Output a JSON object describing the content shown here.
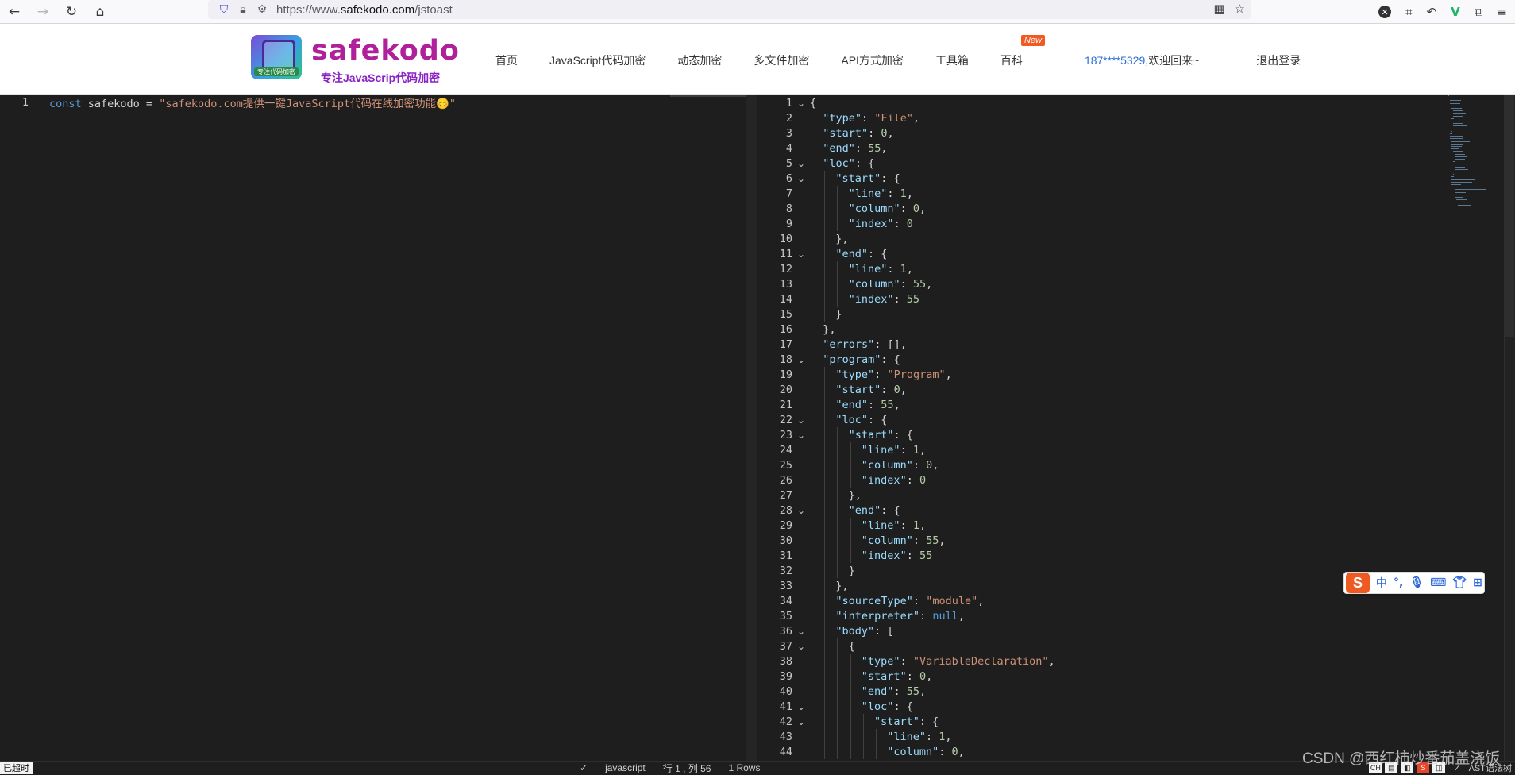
{
  "browser": {
    "url_prefix": "https://www.",
    "url_domain": "safekodo.com",
    "url_path": "/jstoast"
  },
  "site": {
    "logo_name": "safekodo",
    "logo_tagline": "专注JavaScrip代码加密",
    "logo_badge_text": "专注代码加密",
    "nav": [
      {
        "label": "首页"
      },
      {
        "label": "JavaScript代码加密"
      },
      {
        "label": "动态加密"
      },
      {
        "label": "多文件加密"
      },
      {
        "label": "API方式加密"
      },
      {
        "label": "工具箱"
      },
      {
        "label": "百科"
      }
    ],
    "new_badge": "New",
    "user_phone": "187****5329",
    "user_welcome": ",欢迎回来~",
    "logout": "退出登录"
  },
  "left_editor": {
    "line_number": "1",
    "keyword": "const",
    "ident": " safekodo = ",
    "string": "\"safekodo.com提供一键JavaScript代码在线加密功能😊\""
  },
  "right_editor": {
    "lines": [
      {
        "n": "1",
        "fold": true,
        "indent": 0,
        "parts": [
          [
            "p",
            "{"
          ]
        ]
      },
      {
        "n": "2",
        "fold": false,
        "indent": 1,
        "parts": [
          [
            "k",
            "\"type\""
          ],
          [
            "p",
            ": "
          ],
          [
            "s",
            "\"File\""
          ],
          [
            "p",
            ","
          ]
        ]
      },
      {
        "n": "3",
        "fold": false,
        "indent": 1,
        "parts": [
          [
            "k",
            "\"start\""
          ],
          [
            "p",
            ": "
          ],
          [
            "n",
            "0"
          ],
          [
            "p",
            ","
          ]
        ]
      },
      {
        "n": "4",
        "fold": false,
        "indent": 1,
        "parts": [
          [
            "k",
            "\"end\""
          ],
          [
            "p",
            ": "
          ],
          [
            "n",
            "55"
          ],
          [
            "p",
            ","
          ]
        ]
      },
      {
        "n": "5",
        "fold": true,
        "indent": 1,
        "parts": [
          [
            "k",
            "\"loc\""
          ],
          [
            "p",
            ": {"
          ]
        ]
      },
      {
        "n": "6",
        "fold": true,
        "indent": 2,
        "parts": [
          [
            "k",
            "\"start\""
          ],
          [
            "p",
            ": {"
          ]
        ]
      },
      {
        "n": "7",
        "fold": false,
        "indent": 3,
        "parts": [
          [
            "k",
            "\"line\""
          ],
          [
            "p",
            ": "
          ],
          [
            "n",
            "1"
          ],
          [
            "p",
            ","
          ]
        ]
      },
      {
        "n": "8",
        "fold": false,
        "indent": 3,
        "parts": [
          [
            "k",
            "\"column\""
          ],
          [
            "p",
            ": "
          ],
          [
            "n",
            "0"
          ],
          [
            "p",
            ","
          ]
        ]
      },
      {
        "n": "9",
        "fold": false,
        "indent": 3,
        "parts": [
          [
            "k",
            "\"index\""
          ],
          [
            "p",
            ": "
          ],
          [
            "n",
            "0"
          ]
        ]
      },
      {
        "n": "10",
        "fold": false,
        "indent": 2,
        "parts": [
          [
            "p",
            "},"
          ]
        ]
      },
      {
        "n": "11",
        "fold": true,
        "indent": 2,
        "parts": [
          [
            "k",
            "\"end\""
          ],
          [
            "p",
            ": {"
          ]
        ]
      },
      {
        "n": "12",
        "fold": false,
        "indent": 3,
        "parts": [
          [
            "k",
            "\"line\""
          ],
          [
            "p",
            ": "
          ],
          [
            "n",
            "1"
          ],
          [
            "p",
            ","
          ]
        ]
      },
      {
        "n": "13",
        "fold": false,
        "indent": 3,
        "parts": [
          [
            "k",
            "\"column\""
          ],
          [
            "p",
            ": "
          ],
          [
            "n",
            "55"
          ],
          [
            "p",
            ","
          ]
        ]
      },
      {
        "n": "14",
        "fold": false,
        "indent": 3,
        "parts": [
          [
            "k",
            "\"index\""
          ],
          [
            "p",
            ": "
          ],
          [
            "n",
            "55"
          ]
        ]
      },
      {
        "n": "15",
        "fold": false,
        "indent": 2,
        "parts": [
          [
            "p",
            "}"
          ]
        ]
      },
      {
        "n": "16",
        "fold": false,
        "indent": 1,
        "parts": [
          [
            "p",
            "},"
          ]
        ]
      },
      {
        "n": "17",
        "fold": false,
        "indent": 1,
        "parts": [
          [
            "k",
            "\"errors\""
          ],
          [
            "p",
            ": [],"
          ]
        ]
      },
      {
        "n": "18",
        "fold": true,
        "indent": 1,
        "parts": [
          [
            "k",
            "\"program\""
          ],
          [
            "p",
            ": {"
          ]
        ]
      },
      {
        "n": "19",
        "fold": false,
        "indent": 2,
        "parts": [
          [
            "k",
            "\"type\""
          ],
          [
            "p",
            ": "
          ],
          [
            "s",
            "\"Program\""
          ],
          [
            "p",
            ","
          ]
        ]
      },
      {
        "n": "20",
        "fold": false,
        "indent": 2,
        "parts": [
          [
            "k",
            "\"start\""
          ],
          [
            "p",
            ": "
          ],
          [
            "n",
            "0"
          ],
          [
            "p",
            ","
          ]
        ]
      },
      {
        "n": "21",
        "fold": false,
        "indent": 2,
        "parts": [
          [
            "k",
            "\"end\""
          ],
          [
            "p",
            ": "
          ],
          [
            "n",
            "55"
          ],
          [
            "p",
            ","
          ]
        ]
      },
      {
        "n": "22",
        "fold": true,
        "indent": 2,
        "parts": [
          [
            "k",
            "\"loc\""
          ],
          [
            "p",
            ": {"
          ]
        ]
      },
      {
        "n": "23",
        "fold": true,
        "indent": 3,
        "parts": [
          [
            "k",
            "\"start\""
          ],
          [
            "p",
            ": {"
          ]
        ]
      },
      {
        "n": "24",
        "fold": false,
        "indent": 4,
        "parts": [
          [
            "k",
            "\"line\""
          ],
          [
            "p",
            ": "
          ],
          [
            "n",
            "1"
          ],
          [
            "p",
            ","
          ]
        ]
      },
      {
        "n": "25",
        "fold": false,
        "indent": 4,
        "parts": [
          [
            "k",
            "\"column\""
          ],
          [
            "p",
            ": "
          ],
          [
            "n",
            "0"
          ],
          [
            "p",
            ","
          ]
        ]
      },
      {
        "n": "26",
        "fold": false,
        "indent": 4,
        "parts": [
          [
            "k",
            "\"index\""
          ],
          [
            "p",
            ": "
          ],
          [
            "n",
            "0"
          ]
        ]
      },
      {
        "n": "27",
        "fold": false,
        "indent": 3,
        "parts": [
          [
            "p",
            "},"
          ]
        ]
      },
      {
        "n": "28",
        "fold": true,
        "indent": 3,
        "parts": [
          [
            "k",
            "\"end\""
          ],
          [
            "p",
            ": {"
          ]
        ]
      },
      {
        "n": "29",
        "fold": false,
        "indent": 4,
        "parts": [
          [
            "k",
            "\"line\""
          ],
          [
            "p",
            ": "
          ],
          [
            "n",
            "1"
          ],
          [
            "p",
            ","
          ]
        ]
      },
      {
        "n": "30",
        "fold": false,
        "indent": 4,
        "parts": [
          [
            "k",
            "\"column\""
          ],
          [
            "p",
            ": "
          ],
          [
            "n",
            "55"
          ],
          [
            "p",
            ","
          ]
        ]
      },
      {
        "n": "31",
        "fold": false,
        "indent": 4,
        "parts": [
          [
            "k",
            "\"index\""
          ],
          [
            "p",
            ": "
          ],
          [
            "n",
            "55"
          ]
        ]
      },
      {
        "n": "32",
        "fold": false,
        "indent": 3,
        "parts": [
          [
            "p",
            "}"
          ]
        ]
      },
      {
        "n": "33",
        "fold": false,
        "indent": 2,
        "parts": [
          [
            "p",
            "},"
          ]
        ]
      },
      {
        "n": "34",
        "fold": false,
        "indent": 2,
        "parts": [
          [
            "k",
            "\"sourceType\""
          ],
          [
            "p",
            ": "
          ],
          [
            "s",
            "\"module\""
          ],
          [
            "p",
            ","
          ]
        ]
      },
      {
        "n": "35",
        "fold": false,
        "indent": 2,
        "parts": [
          [
            "k",
            "\"interpreter\""
          ],
          [
            "p",
            ": "
          ],
          [
            "v",
            "null"
          ],
          [
            "p",
            ","
          ]
        ]
      },
      {
        "n": "36",
        "fold": true,
        "indent": 2,
        "parts": [
          [
            "k",
            "\"body\""
          ],
          [
            "p",
            ": ["
          ]
        ]
      },
      {
        "n": "37",
        "fold": true,
        "indent": 3,
        "parts": [
          [
            "p",
            "{"
          ]
        ]
      },
      {
        "n": "38",
        "fold": false,
        "indent": 4,
        "parts": [
          [
            "k",
            "\"type\""
          ],
          [
            "p",
            ": "
          ],
          [
            "s",
            "\"VariableDeclaration\""
          ],
          [
            "p",
            ","
          ]
        ]
      },
      {
        "n": "39",
        "fold": false,
        "indent": 4,
        "parts": [
          [
            "k",
            "\"start\""
          ],
          [
            "p",
            ": "
          ],
          [
            "n",
            "0"
          ],
          [
            "p",
            ","
          ]
        ]
      },
      {
        "n": "40",
        "fold": false,
        "indent": 4,
        "parts": [
          [
            "k",
            "\"end\""
          ],
          [
            "p",
            ": "
          ],
          [
            "n",
            "55"
          ],
          [
            "p",
            ","
          ]
        ]
      },
      {
        "n": "41",
        "fold": true,
        "indent": 4,
        "parts": [
          [
            "k",
            "\"loc\""
          ],
          [
            "p",
            ": {"
          ]
        ]
      },
      {
        "n": "42",
        "fold": true,
        "indent": 5,
        "parts": [
          [
            "k",
            "\"start\""
          ],
          [
            "p",
            ": {"
          ]
        ]
      },
      {
        "n": "43",
        "fold": false,
        "indent": 6,
        "parts": [
          [
            "k",
            "\"line\""
          ],
          [
            "p",
            ": "
          ],
          [
            "n",
            "1"
          ],
          [
            "p",
            ","
          ]
        ]
      },
      {
        "n": "44",
        "fold": false,
        "indent": 6,
        "parts": [
          [
            "k",
            "\"column\""
          ],
          [
            "p",
            ": "
          ],
          [
            "n",
            "0"
          ],
          [
            "p",
            ","
          ]
        ]
      }
    ]
  },
  "statusbar": {
    "left_label": "已超时",
    "language": "javascript",
    "position": "行 1 , 列 56",
    "rows": "1 Rows",
    "right_label": "AST语法树",
    "tray_ch": "CH"
  },
  "ime": {
    "logo": "S",
    "lang": "中",
    "punct": "°,",
    "mic_icon": "mic-icon",
    "keyboard_icon": "keyboard-icon",
    "skin_icon": "shirt-icon",
    "grid_icon": "grid-icon"
  },
  "watermark": "CSDN @西红柿炒番茄盖浇饭",
  "colors": {
    "keyword": "#569cd6",
    "string": "#ce9178",
    "json_key": "#9cdcfe",
    "number": "#b5cea8",
    "brand": "#b0209a",
    "link": "#2c6fd6"
  }
}
